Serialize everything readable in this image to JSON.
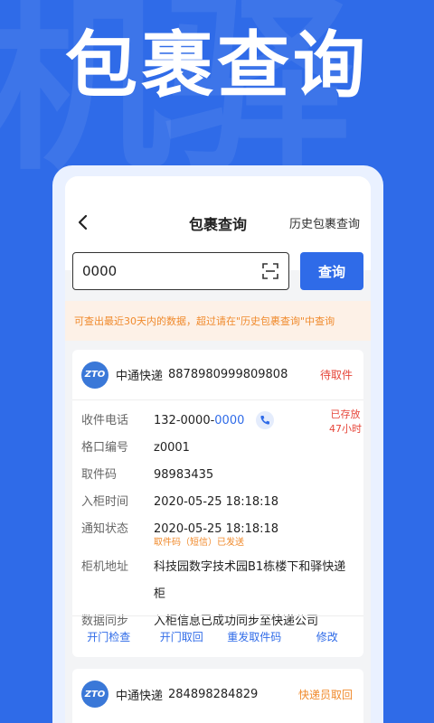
{
  "hero": {
    "title": "包裹查询"
  },
  "topbar": {
    "title": "包裹查询",
    "history_link": "历史包裹查询"
  },
  "search": {
    "value": "0000",
    "button_label": "查询"
  },
  "notice": "可查出最近30天内的数据，超过请在\"历史包裹查询\"中查询",
  "parcels": [
    {
      "logo_text": "ZTO",
      "courier": "中通快递",
      "tracking_no": "8878980999809808",
      "status": "待取件",
      "stored_label": "已存放",
      "stored_hours": "47小时",
      "fields": {
        "phone_label": "收件电话",
        "phone_prefix": "132-0000-",
        "phone_suffix": "0000",
        "slot_label": "格口编号",
        "slot_value": "z0001",
        "code_label": "取件码",
        "code_value": "98983435",
        "in_time_label": "入柜时间",
        "in_time_value": "2020-05-25  18:18:18",
        "notify_label": "通知状态",
        "notify_value": "2020-05-25  18:18:18",
        "notify_note": "取件码（短信）已发送",
        "address_label": "柜机地址",
        "address_value": "科技园数字技术园B1栋楼下和驿快递柜",
        "sync_label": "数据同步",
        "sync_value": "入柜信息已成功同步至快递公司"
      },
      "actions": [
        "开门检查",
        "开门取回",
        "重发取件码",
        "修改"
      ]
    },
    {
      "logo_text": "ZTO",
      "courier": "中通快递",
      "tracking_no": "284898284829",
      "status": "快递员取回"
    }
  ]
}
